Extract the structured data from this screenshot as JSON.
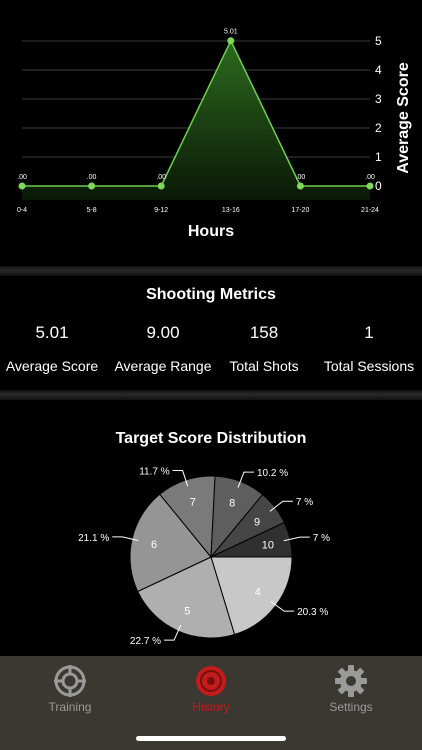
{
  "chart_data": [
    {
      "type": "area",
      "categories": [
        "0-4",
        "5-8",
        "9-12",
        "13-16",
        "17-20",
        "21-24"
      ],
      "values": [
        0,
        0,
        0,
        5.01,
        0,
        0
      ],
      "data_labels": [
        ".00",
        ".00",
        ".00",
        "5.01",
        ".00",
        ".00"
      ],
      "xlabel": "Hours",
      "ylabel": "Average Score",
      "ylim": [
        0,
        5
      ],
      "y_ticks": [
        "0",
        "1",
        "2",
        "3",
        "4",
        "5"
      ],
      "grid": true,
      "colors": {
        "line": "#6fcf4f",
        "point": "#7fd85a",
        "fill_top": "#2f6f20",
        "fill_bottom": "#0a1a06"
      }
    },
    {
      "type": "pie",
      "title": "Target Score Distribution",
      "slices": [
        {
          "label": "4",
          "value": 20.3,
          "pct_label": "20.3 %",
          "color": "#c8c8c8"
        },
        {
          "label": "5",
          "value": 22.7,
          "pct_label": "22.7 %",
          "color": "#afafaf"
        },
        {
          "label": "6",
          "value": 21.1,
          "pct_label": "21.1 %",
          "color": "#959595"
        },
        {
          "label": "7",
          "value": 11.7,
          "pct_label": "11.7 %",
          "color": "#7a7a7a"
        },
        {
          "label": "8",
          "value": 10.2,
          "pct_label": "10.2 %",
          "color": "#5e5e5e"
        },
        {
          "label": "9",
          "value": 7,
          "pct_label": "7 %",
          "color": "#464646"
        },
        {
          "label": "10",
          "value": 7,
          "pct_label": "7 %",
          "color": "#303030"
        }
      ]
    }
  ],
  "metrics": {
    "title": "Shooting Metrics",
    "items": [
      {
        "value": "5.01",
        "label": "Average Score"
      },
      {
        "value": "9.00",
        "label": "Average Range"
      },
      {
        "value": "158",
        "label": "Total Shots"
      },
      {
        "value": "1",
        "label": "Total Sessions"
      }
    ]
  },
  "tabs": [
    {
      "label": "Training",
      "icon": "crosshair-icon",
      "active": false
    },
    {
      "label": "History",
      "icon": "target-icon",
      "active": true
    },
    {
      "label": "Settings",
      "icon": "gear-icon",
      "active": false
    }
  ]
}
